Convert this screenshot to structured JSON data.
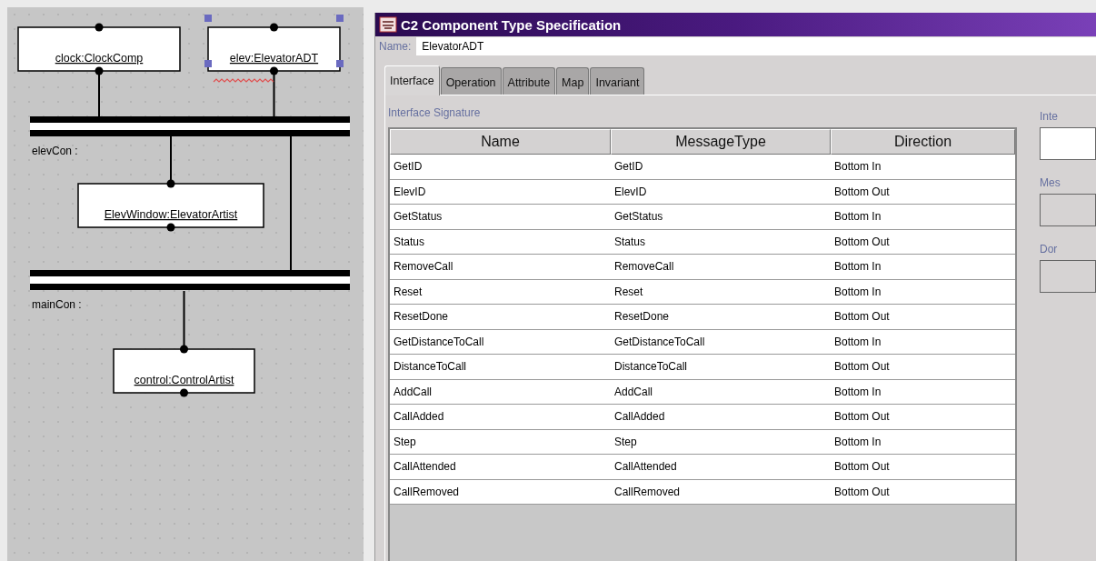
{
  "diagram": {
    "components": [
      {
        "label": "clock:ClockComp",
        "selected": false,
        "flagged": false
      },
      {
        "label": "elev:ElevatorADT",
        "selected": true,
        "flagged": true
      },
      {
        "label": "ElevWindow:ElevatorArtist",
        "selected": false,
        "flagged": false
      },
      {
        "label": "control:ControlArtist",
        "selected": false,
        "flagged": false
      }
    ],
    "connectors": [
      {
        "label": "elevCon :"
      },
      {
        "label": "mainCon :"
      }
    ]
  },
  "window": {
    "title": "C2 Component Type Specification"
  },
  "name_field": {
    "label": "Name:",
    "value": "ElevatorADT"
  },
  "tabs": [
    {
      "label": "Interface",
      "selected": true
    },
    {
      "label": "Operation",
      "selected": false
    },
    {
      "label": "Attribute",
      "selected": false
    },
    {
      "label": "Map",
      "selected": false
    },
    {
      "label": "Invariant",
      "selected": false
    }
  ],
  "section_label": "Interface Signature",
  "table": {
    "columns": [
      "Name",
      "MessageType",
      "Direction"
    ],
    "rows": [
      [
        "GetID",
        "GetID",
        "Bottom In"
      ],
      [
        "ElevID",
        "ElevID",
        "Bottom Out"
      ],
      [
        "GetStatus",
        "GetStatus",
        "Bottom In"
      ],
      [
        "Status",
        "Status",
        "Bottom Out"
      ],
      [
        "RemoveCall",
        "RemoveCall",
        "Bottom In"
      ],
      [
        "Reset",
        "Reset",
        "Bottom In"
      ],
      [
        "ResetDone",
        "ResetDone",
        "Bottom Out"
      ],
      [
        "GetDistanceToCall",
        "GetDistanceToCall",
        "Bottom In"
      ],
      [
        "DistanceToCall",
        "DistanceToCall",
        "Bottom Out"
      ],
      [
        "AddCall",
        "AddCall",
        "Bottom In"
      ],
      [
        "CallAdded",
        "CallAdded",
        "Bottom Out"
      ],
      [
        "Step",
        "Step",
        "Bottom In"
      ],
      [
        "CallAttended",
        "CallAttended",
        "Bottom Out"
      ],
      [
        "CallRemoved",
        "CallRemoved",
        "Bottom Out"
      ]
    ]
  },
  "side_fields": [
    {
      "label": "Inte"
    },
    {
      "label": "Mes"
    },
    {
      "label": "Dor"
    }
  ]
}
